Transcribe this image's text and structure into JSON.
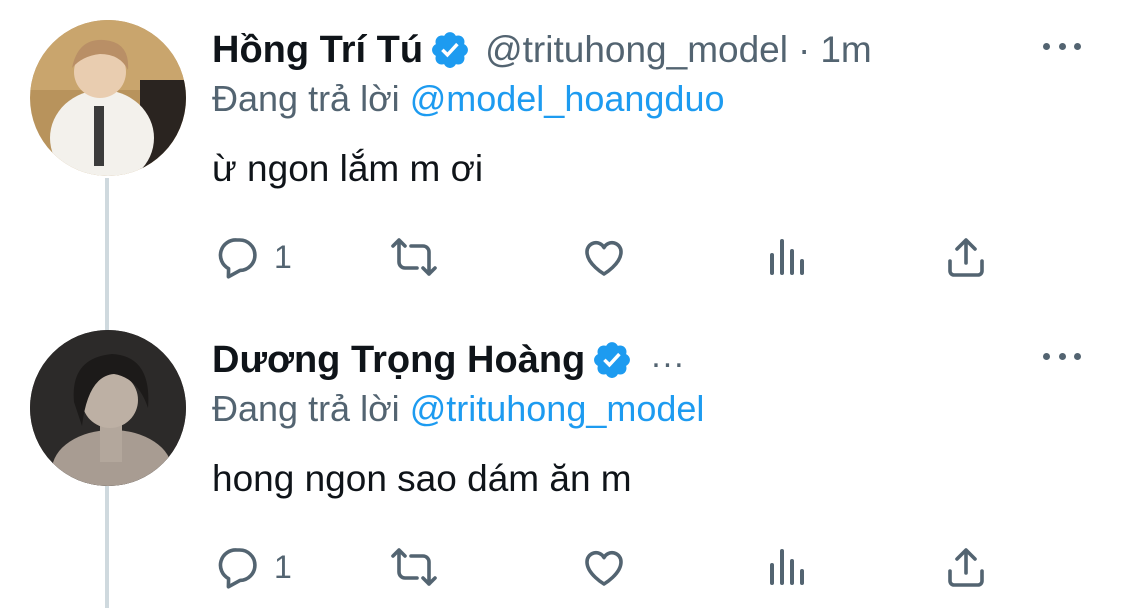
{
  "tweets": [
    {
      "display_name": "Hồng Trí Tú",
      "handle": "@trituhong_model",
      "dot": "·",
      "time": "1m",
      "reply_prefix": "Đang trả lời",
      "reply_to": "@model_hoangduo",
      "text": "ừ ngon lắm m ơi",
      "reply_count": "1"
    },
    {
      "display_name": "Dương Trọng Hoàng",
      "handle_truncated": "...",
      "reply_prefix": "Đang trả lời",
      "reply_to": "@trituhong_model",
      "text": "hong ngon sao dám ăn m",
      "reply_count": "1"
    }
  ],
  "colors": {
    "accent": "#1d9bf0",
    "secondary_text": "#536471",
    "primary_text": "#0f1419",
    "thread_line": "#cfd9de"
  },
  "icons": [
    "verified-badge-icon",
    "more-icon",
    "reply-icon",
    "retweet-icon",
    "like-icon",
    "analytics-icon",
    "share-icon"
  ]
}
